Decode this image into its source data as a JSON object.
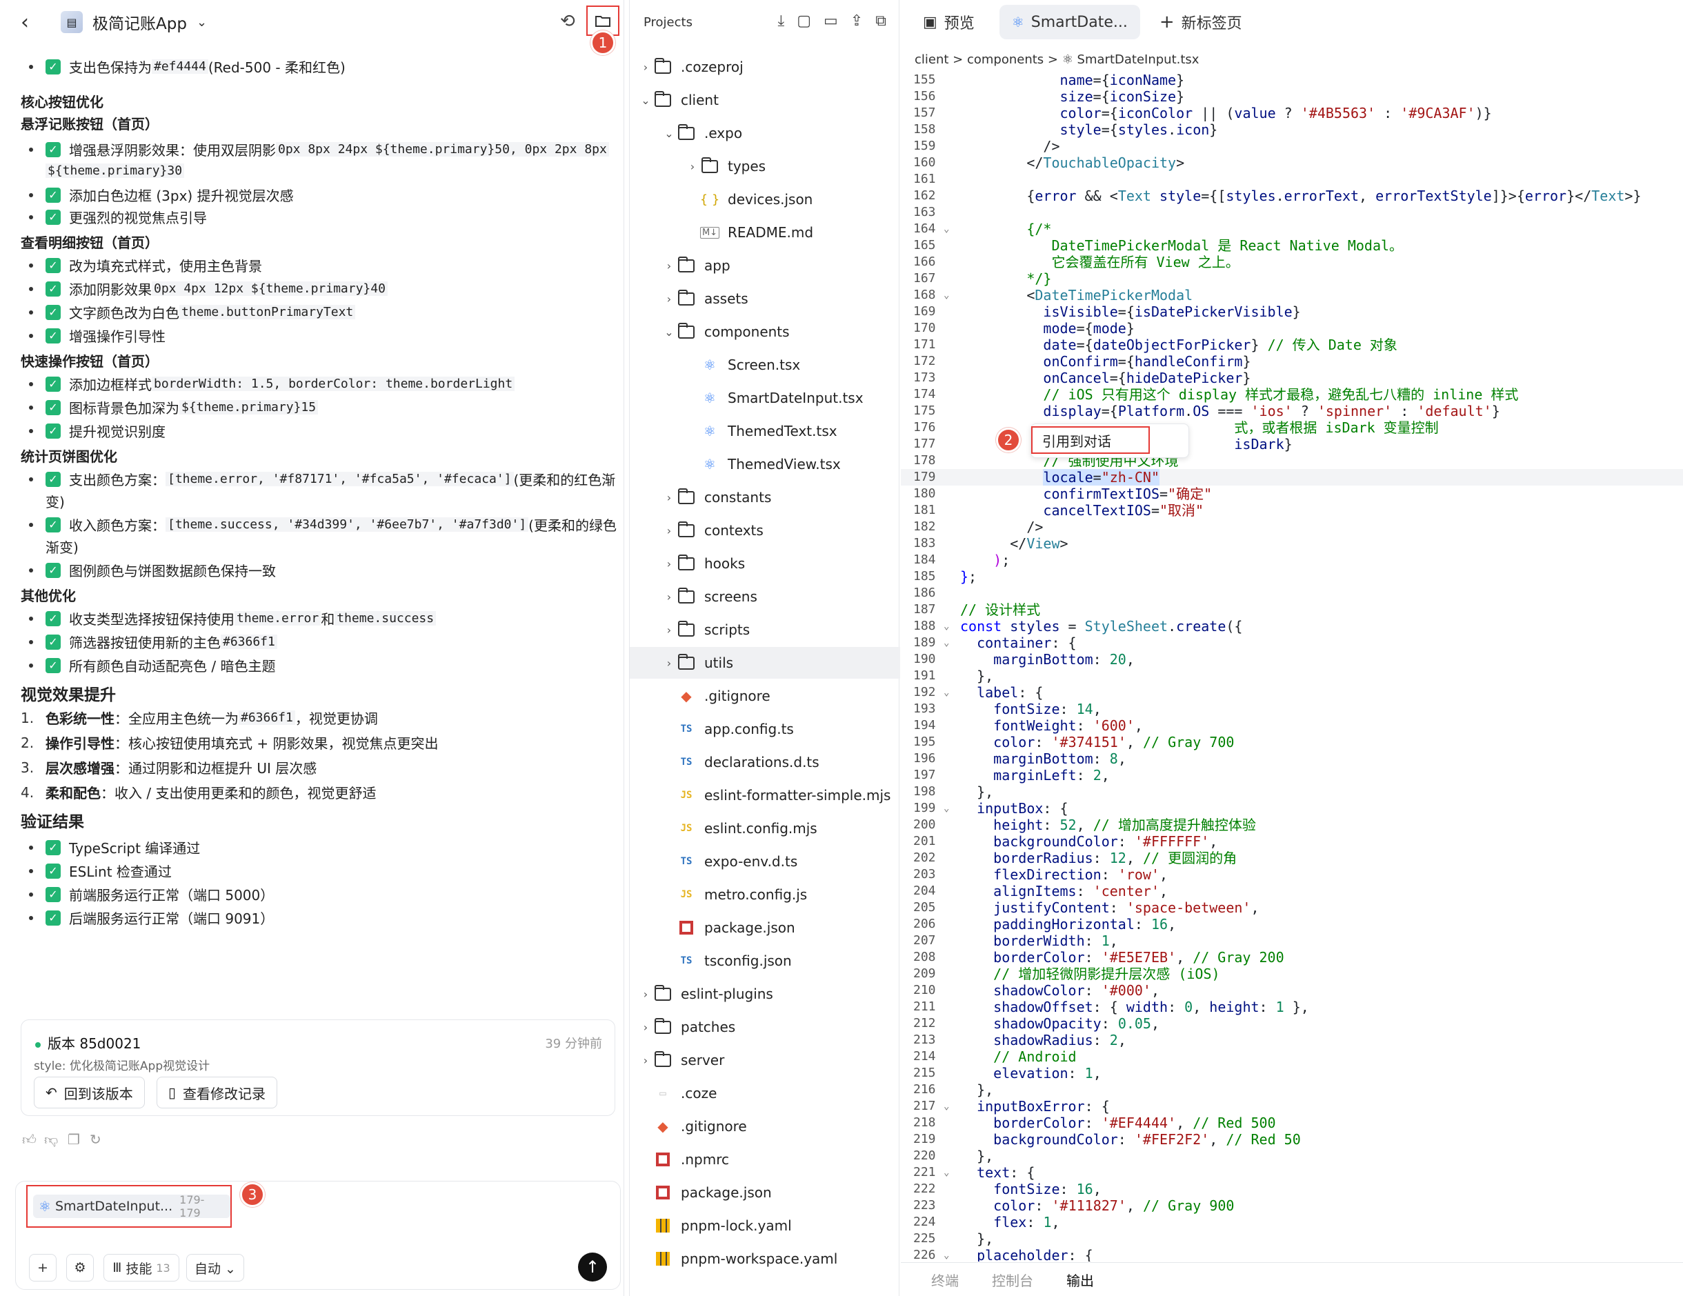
{
  "header": {
    "back": "‹",
    "app_title": "极简记账App",
    "caret": "⌄",
    "history_icon": "history-icon",
    "folder_icon": "folder-icon",
    "badge1": "1"
  },
  "chat": {
    "items": [
      {
        "type": "check",
        "text": "支出色保持为 ",
        "code": "#ef4444",
        "tail": " (Red-500 - 柔和红色)"
      },
      {
        "type": "h4",
        "text": "核心按钮优化"
      },
      {
        "type": "h4",
        "text": "悬浮记账按钮（首页）"
      },
      {
        "type": "check",
        "text": "增强悬浮阴影效果：使用双层阴影 ",
        "code": "0px 8px 24px ${theme.primary}50, 0px 2px 8px",
        "tail": ""
      },
      {
        "type": "cont",
        "code": "${theme.primary}30"
      },
      {
        "type": "check",
        "text": "添加白色边框 (3px) 提升视觉层次感"
      },
      {
        "type": "check",
        "text": "更强烈的视觉焦点引导"
      },
      {
        "type": "h4",
        "text": "查看明细按钮（首页）"
      },
      {
        "type": "check",
        "text": "改为填充式样式，使用主色背景"
      },
      {
        "type": "check",
        "text": "添加阴影效果 ",
        "code": "0px 4px 12px ${theme.primary}40",
        "tail": ""
      },
      {
        "type": "check",
        "text": "文字颜色改为白色 ",
        "code": "theme.buttonPrimaryText",
        "tail": ""
      },
      {
        "type": "check",
        "text": "增强操作引导性"
      },
      {
        "type": "h4",
        "text": "快速操作按钮（首页）"
      },
      {
        "type": "check",
        "text": "添加边框样式 ",
        "code": "borderWidth: 1.5, borderColor: theme.borderLight",
        "tail": ""
      },
      {
        "type": "check",
        "text": "图标背景色加深为 ",
        "code": "${theme.primary}15",
        "tail": ""
      },
      {
        "type": "check",
        "text": "提升视觉识别度"
      },
      {
        "type": "h4",
        "text": "统计页饼图优化"
      },
      {
        "type": "check",
        "text": "支出颜色方案：",
        "code": "[theme.error, '#f87171', '#fca5a5', '#fecaca']",
        "tail": " (更柔和的红色渐"
      },
      {
        "type": "cont2",
        "text": "变)"
      },
      {
        "type": "check",
        "text": "收入颜色方案：",
        "code": "[theme.success, '#34d399', '#6ee7b7', '#a7f3d0']",
        "tail": " (更柔和的绿色"
      },
      {
        "type": "cont2",
        "text": "渐变)"
      },
      {
        "type": "check",
        "text": "图例颜色与饼图数据颜色保持一致"
      },
      {
        "type": "h4",
        "text": "其他优化"
      },
      {
        "type": "check",
        "text": "收支类型选择按钮保持使用 ",
        "code": "theme.error",
        "tail": " 和 ",
        "code2": "theme.success"
      },
      {
        "type": "check",
        "text": "筛选器按钮使用新的主色 ",
        "code": "#6366f1",
        "tail": ""
      },
      {
        "type": "check",
        "text": "所有颜色自动适配亮色 / 暗色主题"
      },
      {
        "type": "h3",
        "text": "视觉效果提升"
      },
      {
        "type": "ol",
        "num": "1.",
        "bold": "色彩统一性",
        "text": "：全应用主色统一为 ",
        "code": "#6366f1",
        "tail": "，视觉更协调"
      },
      {
        "type": "ol",
        "num": "2.",
        "bold": "操作引导性",
        "text": "：核心按钮使用填充式 + 阴影效果，视觉焦点更突出"
      },
      {
        "type": "ol",
        "num": "3.",
        "bold": "层次感增强",
        "text": "：通过阴影和边框提升 UI 层次感"
      },
      {
        "type": "ol",
        "num": "4.",
        "bold": "柔和配色",
        "text": "：收入 / 支出使用更柔和的颜色，视觉更舒适"
      },
      {
        "type": "h3",
        "text": "验证结果"
      },
      {
        "type": "check",
        "text": "TypeScript 编译通过"
      },
      {
        "type": "check",
        "text": "ESLint 检查通过"
      },
      {
        "type": "check",
        "text": "前端服务运行正常（端口 5000）"
      },
      {
        "type": "check",
        "text": "后端服务运行正常（端口 9091）"
      }
    ],
    "version": {
      "title": "版本 85d0021",
      "time": "39 分钟前",
      "subtitle": "style: 优化极简记账App视觉设计",
      "rollback": "回到该版本",
      "view_changes": "查看修改记录"
    },
    "chip": {
      "label": "SmartDateInput...",
      "range": "179-179",
      "badge": "3"
    },
    "controls": {
      "plus": "+",
      "skills": "技能",
      "skills_count": "13",
      "mode": "自动 ⌄",
      "send": "↑"
    }
  },
  "explorer": {
    "title": "Projects",
    "rows": [
      {
        "indent": 0,
        "tw": "›",
        "icon": "folder",
        "name": ".cozeproj"
      },
      {
        "indent": 0,
        "tw": "⌄",
        "icon": "folder",
        "name": "client"
      },
      {
        "indent": 1,
        "tw": "⌄",
        "icon": "folder",
        "name": ".expo"
      },
      {
        "indent": 2,
        "tw": "›",
        "icon": "folder",
        "name": "types"
      },
      {
        "indent": 2,
        "tw": "•",
        "icon": "json",
        "name": "devices.json"
      },
      {
        "indent": 2,
        "tw": "•",
        "icon": "md",
        "name": "README.md"
      },
      {
        "indent": 1,
        "tw": "›",
        "icon": "folder",
        "name": "app"
      },
      {
        "indent": 1,
        "tw": "›",
        "icon": "folder",
        "name": "assets"
      },
      {
        "indent": 1,
        "tw": "⌄",
        "icon": "folder",
        "name": "components"
      },
      {
        "indent": 2,
        "tw": "•",
        "icon": "react",
        "name": "Screen.tsx"
      },
      {
        "indent": 2,
        "tw": "•",
        "icon": "react",
        "name": "SmartDateInput.tsx"
      },
      {
        "indent": 2,
        "tw": "•",
        "icon": "react",
        "name": "ThemedText.tsx"
      },
      {
        "indent": 2,
        "tw": "•",
        "icon": "react",
        "name": "ThemedView.tsx"
      },
      {
        "indent": 1,
        "tw": "›",
        "icon": "folder",
        "name": "constants"
      },
      {
        "indent": 1,
        "tw": "›",
        "icon": "folder",
        "name": "contexts"
      },
      {
        "indent": 1,
        "tw": "›",
        "icon": "folder",
        "name": "hooks"
      },
      {
        "indent": 1,
        "tw": "›",
        "icon": "folder",
        "name": "screens"
      },
      {
        "indent": 1,
        "tw": "›",
        "icon": "folder",
        "name": "scripts"
      },
      {
        "indent": 1,
        "tw": "›",
        "icon": "folder",
        "name": "utils",
        "sel": true
      },
      {
        "indent": 1,
        "tw": "•",
        "icon": "git",
        "name": ".gitignore"
      },
      {
        "indent": 1,
        "tw": "•",
        "icon": "ts",
        "name": "app.config.ts"
      },
      {
        "indent": 1,
        "tw": "•",
        "icon": "ts",
        "name": "declarations.d.ts"
      },
      {
        "indent": 1,
        "tw": "•",
        "icon": "js",
        "name": "eslint-formatter-simple.mjs"
      },
      {
        "indent": 1,
        "tw": "•",
        "icon": "js",
        "name": "eslint.config.mjs"
      },
      {
        "indent": 1,
        "tw": "•",
        "icon": "ts",
        "name": "expo-env.d.ts"
      },
      {
        "indent": 1,
        "tw": "•",
        "icon": "js",
        "name": "metro.config.js"
      },
      {
        "indent": 1,
        "tw": "•",
        "icon": "npm",
        "name": "package.json"
      },
      {
        "indent": 1,
        "tw": "•",
        "icon": "ts",
        "name": "tsconfig.json"
      },
      {
        "indent": 0,
        "tw": "›",
        "icon": "folder",
        "name": "eslint-plugins"
      },
      {
        "indent": 0,
        "tw": "›",
        "icon": "folder",
        "name": "patches"
      },
      {
        "indent": 0,
        "tw": "›",
        "icon": "folder",
        "name": "server"
      },
      {
        "indent": 0,
        "tw": "•",
        "icon": "file",
        "name": ".coze"
      },
      {
        "indent": 0,
        "tw": "•",
        "icon": "git",
        "name": ".gitignore"
      },
      {
        "indent": 0,
        "tw": "•",
        "icon": "npm",
        "name": ".npmrc"
      },
      {
        "indent": 0,
        "tw": "•",
        "icon": "npm",
        "name": "package.json"
      },
      {
        "indent": 0,
        "tw": "•",
        "icon": "yaml",
        "name": "pnpm-lock.yaml"
      },
      {
        "indent": 0,
        "tw": "•",
        "icon": "yaml",
        "name": "pnpm-workspace.yaml"
      }
    ]
  },
  "editor": {
    "tabs": {
      "preview": "预览",
      "file": "SmartDate...",
      "newtab": "新标签页"
    },
    "breadcrumb": "client  >  components  >  ⚛ SmartDateInput.tsx",
    "context_menu": {
      "label": "引用到对话",
      "badge": "2"
    },
    "bottom_tabs": {
      "terminal": "终端",
      "console": "控制台",
      "output": "输出"
    },
    "lines": [
      {
        "n": "155",
        "h": "            <span class='p'>name</span>={<span class='p'>iconName</span>}"
      },
      {
        "n": "156",
        "h": "            <span class='p'>size</span>={<span class='p'>iconSize</span>}"
      },
      {
        "n": "157",
        "h": "            <span class='p'>color</span>={<span class='p'>iconColor</span> || (<span class='p'>value</span> ? <span class='s'>'#4B5563'</span> : <span class='s'>'#9CA3AF'</span>)}"
      },
      {
        "n": "158",
        "h": "            <span class='p'>style</span>={<span class='p'>styles</span>.<span class='p'>icon</span>}"
      },
      {
        "n": "159",
        "h": "          /&gt;"
      },
      {
        "n": "160",
        "h": "        &lt;/<span class='tag'>TouchableOpacity</span>&gt;"
      },
      {
        "n": "161",
        "h": ""
      },
      {
        "n": "162",
        "h": "        {<span class='p'>error</span> &amp;&amp; &lt;<span class='tag'>Text</span> <span class='p'>style</span>={[<span class='p'>styles</span>.<span class='p'>errorText</span>, <span class='p'>errorTextStyle</span>]}&gt;{<span class='p'>error</span>}&lt;/<span class='tag'>Text</span>&gt;}"
      },
      {
        "n": "163",
        "h": ""
      },
      {
        "n": "164",
        "f": true,
        "h": "        <span class='c'>{/*</span>"
      },
      {
        "n": "165",
        "h": "<span class='c'>           DateTimePickerModal 是 React Native Modal。</span>"
      },
      {
        "n": "166",
        "h": "<span class='c'>           它会覆盖在所有 View 之上。</span>"
      },
      {
        "n": "167",
        "h": "<span class='c'>        */}</span>"
      },
      {
        "n": "168",
        "f": true,
        "h": "        &lt;<span class='tag'>DateTimePickerModal</span>"
      },
      {
        "n": "169",
        "h": "          <span class='p'>isVisible</span>={<span class='p'>isDatePickerVisible</span>}"
      },
      {
        "n": "170",
        "h": "          <span class='p'>mode</span>={<span class='p'>mode</span>}"
      },
      {
        "n": "171",
        "h": "          <span class='p'>date</span>={<span class='p'>dateObjectForPicker</span>} <span class='c'>// 传入 Date 对象</span>"
      },
      {
        "n": "172",
        "h": "          <span class='p'>onConfirm</span>={<span class='p'>handleConfirm</span>}"
      },
      {
        "n": "173",
        "h": "          <span class='p'>onCancel</span>={<span class='p'>hideDatePicker</span>}"
      },
      {
        "n": "174",
        "h": "          <span class='c'>// iOS 只有用这个 display 样式才最稳，避免乱七八糟的 inline 样式</span>"
      },
      {
        "n": "175",
        "h": "          <span class='p'>display</span>={<span class='p'>Platform</span>.<span class='p'>OS</span> === <span class='s'>'ios'</span> ? <span class='s'>'spinner'</span> : <span class='s'>'default'</span>}"
      },
      {
        "n": "176",
        "h": "                                 <span class='c'>式，或者根据 isDark 变量控制</span>"
      },
      {
        "n": "177",
        "h": "                                 <span class='p'>isDark</span>}"
      },
      {
        "n": "178",
        "h": "          <span class='c'>// 强制使用中文环境</span>"
      },
      {
        "n": "179",
        "cur": true,
        "h": "          <span class='hl'><span class='p'>locale</span>=<span class='s'>\"zh-CN\"</span></span>"
      },
      {
        "n": "180",
        "h": "          <span class='p'>confirmTextIOS</span>=<span class='s'>\"确定\"</span>"
      },
      {
        "n": "181",
        "h": "          <span class='p'>cancelTextIOS</span>=<span class='s'>\"取消\"</span>"
      },
      {
        "n": "182",
        "h": "        /&gt;"
      },
      {
        "n": "183",
        "h": "      &lt;/<span class='tag'>View</span>&gt;"
      },
      {
        "n": "184",
        "h": "    <span class='br'>)</span>;"
      },
      {
        "n": "185",
        "h": "<span class='k'>}</span>;"
      },
      {
        "n": "186",
        "h": ""
      },
      {
        "n": "187",
        "h": "<span class='c'>// 设计样式</span>"
      },
      {
        "n": "188",
        "f": true,
        "h": "<span class='k'>const</span> <span class='p'>styles</span> = <span class='tag'>StyleSheet</span>.<span class='p'>create</span>({"
      },
      {
        "n": "189",
        "f": true,
        "h": "  <span class='p'>container</span>: {"
      },
      {
        "n": "190",
        "h": "    <span class='p'>marginBottom</span>: <span class='n'>20</span>,"
      },
      {
        "n": "191",
        "h": "  },"
      },
      {
        "n": "192",
        "f": true,
        "h": "  <span class='p'>label</span>: {"
      },
      {
        "n": "193",
        "h": "    <span class='p'>fontSize</span>: <span class='n'>14</span>,"
      },
      {
        "n": "194",
        "h": "    <span class='p'>fontWeight</span>: <span class='s'>'600'</span>,"
      },
      {
        "n": "195",
        "h": "    <span class='p'>color</span>: <span class='s'>'#374151'</span>, <span class='c'>// Gray 700</span>"
      },
      {
        "n": "196",
        "h": "    <span class='p'>marginBottom</span>: <span class='n'>8</span>,"
      },
      {
        "n": "197",
        "h": "    <span class='p'>marginLeft</span>: <span class='n'>2</span>,"
      },
      {
        "n": "198",
        "h": "  },"
      },
      {
        "n": "199",
        "f": true,
        "h": "  <span class='p'>inputBox</span>: {"
      },
      {
        "n": "200",
        "h": "    <span class='p'>height</span>: <span class='n'>52</span>, <span class='c'>// 增加高度提升触控体验</span>"
      },
      {
        "n": "201",
        "h": "    <span class='p'>backgroundColor</span>: <span class='s'>'#FFFFFF'</span>,"
      },
      {
        "n": "202",
        "h": "    <span class='p'>borderRadius</span>: <span class='n'>12</span>, <span class='c'>// 更圆润的角</span>"
      },
      {
        "n": "203",
        "h": "    <span class='p'>flexDirection</span>: <span class='s'>'row'</span>,"
      },
      {
        "n": "204",
        "h": "    <span class='p'>alignItems</span>: <span class='s'>'center'</span>,"
      },
      {
        "n": "205",
        "h": "    <span class='p'>justifyContent</span>: <span class='s'>'space-between'</span>,"
      },
      {
        "n": "206",
        "h": "    <span class='p'>paddingHorizontal</span>: <span class='n'>16</span>,"
      },
      {
        "n": "207",
        "h": "    <span class='p'>borderWidth</span>: <span class='n'>1</span>,"
      },
      {
        "n": "208",
        "h": "    <span class='p'>borderColor</span>: <span class='s'>'#E5E7EB'</span>, <span class='c'>// Gray 200</span>"
      },
      {
        "n": "209",
        "h": "    <span class='c'>// 增加轻微阴影提升层次感 (iOS)</span>"
      },
      {
        "n": "210",
        "h": "    <span class='p'>shadowColor</span>: <span class='s'>'#000'</span>,"
      },
      {
        "n": "211",
        "h": "    <span class='p'>shadowOffset</span>: { <span class='p'>width</span>: <span class='n'>0</span>, <span class='p'>height</span>: <span class='n'>1</span> },"
      },
      {
        "n": "212",
        "h": "    <span class='p'>shadowOpacity</span>: <span class='n'>0.05</span>,"
      },
      {
        "n": "213",
        "h": "    <span class='p'>shadowRadius</span>: <span class='n'>2</span>,"
      },
      {
        "n": "214",
        "h": "    <span class='c'>// Android</span>"
      },
      {
        "n": "215",
        "h": "    <span class='p'>elevation</span>: <span class='n'>1</span>,"
      },
      {
        "n": "216",
        "h": "  },"
      },
      {
        "n": "217",
        "f": true,
        "h": "  <span class='p'>inputBoxError</span>: {"
      },
      {
        "n": "218",
        "h": "    <span class='p'>borderColor</span>: <span class='s'>'#EF4444'</span>, <span class='c'>// Red 500</span>"
      },
      {
        "n": "219",
        "h": "    <span class='p'>backgroundColor</span>: <span class='s'>'#FEF2F2'</span>, <span class='c'>// Red 50</span>"
      },
      {
        "n": "220",
        "h": "  },"
      },
      {
        "n": "221",
        "f": true,
        "h": "  <span class='p'>text</span>: {"
      },
      {
        "n": "222",
        "h": "    <span class='p'>fontSize</span>: <span class='n'>16</span>,"
      },
      {
        "n": "223",
        "h": "    <span class='p'>color</span>: <span class='s'>'#111827'</span>, <span class='c'>// Gray 900</span>"
      },
      {
        "n": "224",
        "h": "    <span class='p'>flex</span>: <span class='n'>1</span>,"
      },
      {
        "n": "225",
        "h": "  },"
      },
      {
        "n": "226",
        "f": true,
        "h": "  <span class='p'>placeholder</span>: {"
      }
    ]
  }
}
